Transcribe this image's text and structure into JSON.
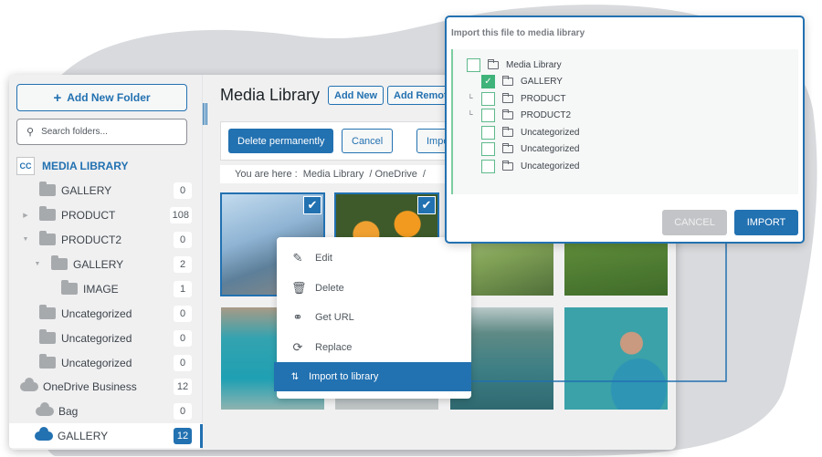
{
  "colors": {
    "accent": "#2271b1",
    "check_green": "#3fb37a"
  },
  "sidebar": {
    "add_folder_label": "Add New Folder",
    "search_placeholder": "Search folders...",
    "root_label": "MEDIA LIBRARY",
    "items": [
      {
        "label": "GALLERY",
        "count": "0",
        "type": "folder",
        "depth": 1
      },
      {
        "label": "PRODUCT",
        "count": "108",
        "type": "folder",
        "depth": 1,
        "arrow": "right"
      },
      {
        "label": "PRODUCT2",
        "count": "0",
        "type": "folder",
        "depth": 1,
        "arrow": "down"
      },
      {
        "label": "GALLERY",
        "count": "2",
        "type": "folder",
        "depth": 2,
        "arrow": "down"
      },
      {
        "label": "IMAGE",
        "count": "1",
        "type": "folder",
        "depth": 3
      },
      {
        "label": "Uncategorized",
        "count": "0",
        "type": "folder",
        "depth": 1
      },
      {
        "label": "Uncategorized",
        "count": "0",
        "type": "folder",
        "depth": 1
      },
      {
        "label": "Uncategorized",
        "count": "0",
        "type": "folder",
        "depth": 1
      },
      {
        "label": "OneDrive Business",
        "count": "12",
        "type": "cloud",
        "depth": 0
      },
      {
        "label": "Bag",
        "count": "0",
        "type": "cloud",
        "depth": 1
      },
      {
        "label": "GALLERY",
        "count": "12",
        "type": "cloud",
        "depth": 1,
        "selected": true
      }
    ]
  },
  "header": {
    "title": "Media Library",
    "add_new": "Add New",
    "add_remote": "Add Remote"
  },
  "toolbar": {
    "delete_permanently": "Delete permanently",
    "cancel": "Cancel",
    "import": "Import"
  },
  "breadcrumb": {
    "prefix": "You are here  :",
    "path": [
      "Media Library",
      "/ OneDrive",
      "/"
    ]
  },
  "context_menu": {
    "items": [
      {
        "label": "Edit",
        "icon": "pencil-icon"
      },
      {
        "label": "Delete",
        "icon": "trash-icon"
      },
      {
        "label": "Get URL",
        "icon": "link-icon"
      },
      {
        "label": "Replace",
        "icon": "refresh-icon"
      },
      {
        "label": "Import to library",
        "icon": "import-icon",
        "highlighted": true
      }
    ]
  },
  "dialog": {
    "title": "Import this file to media library",
    "tree": [
      {
        "label": "Media Library",
        "checked": false
      },
      {
        "label": "GALLERY",
        "checked": true
      },
      {
        "label": "PRODUCT",
        "checked": false
      },
      {
        "label": "PRODUCT2",
        "checked": false
      },
      {
        "label": "Uncategorized",
        "checked": false
      },
      {
        "label": "Uncategorized",
        "checked": false
      },
      {
        "label": "Uncategorized",
        "checked": false
      }
    ],
    "cancel": "CANCEL",
    "import": "IMPORT"
  }
}
